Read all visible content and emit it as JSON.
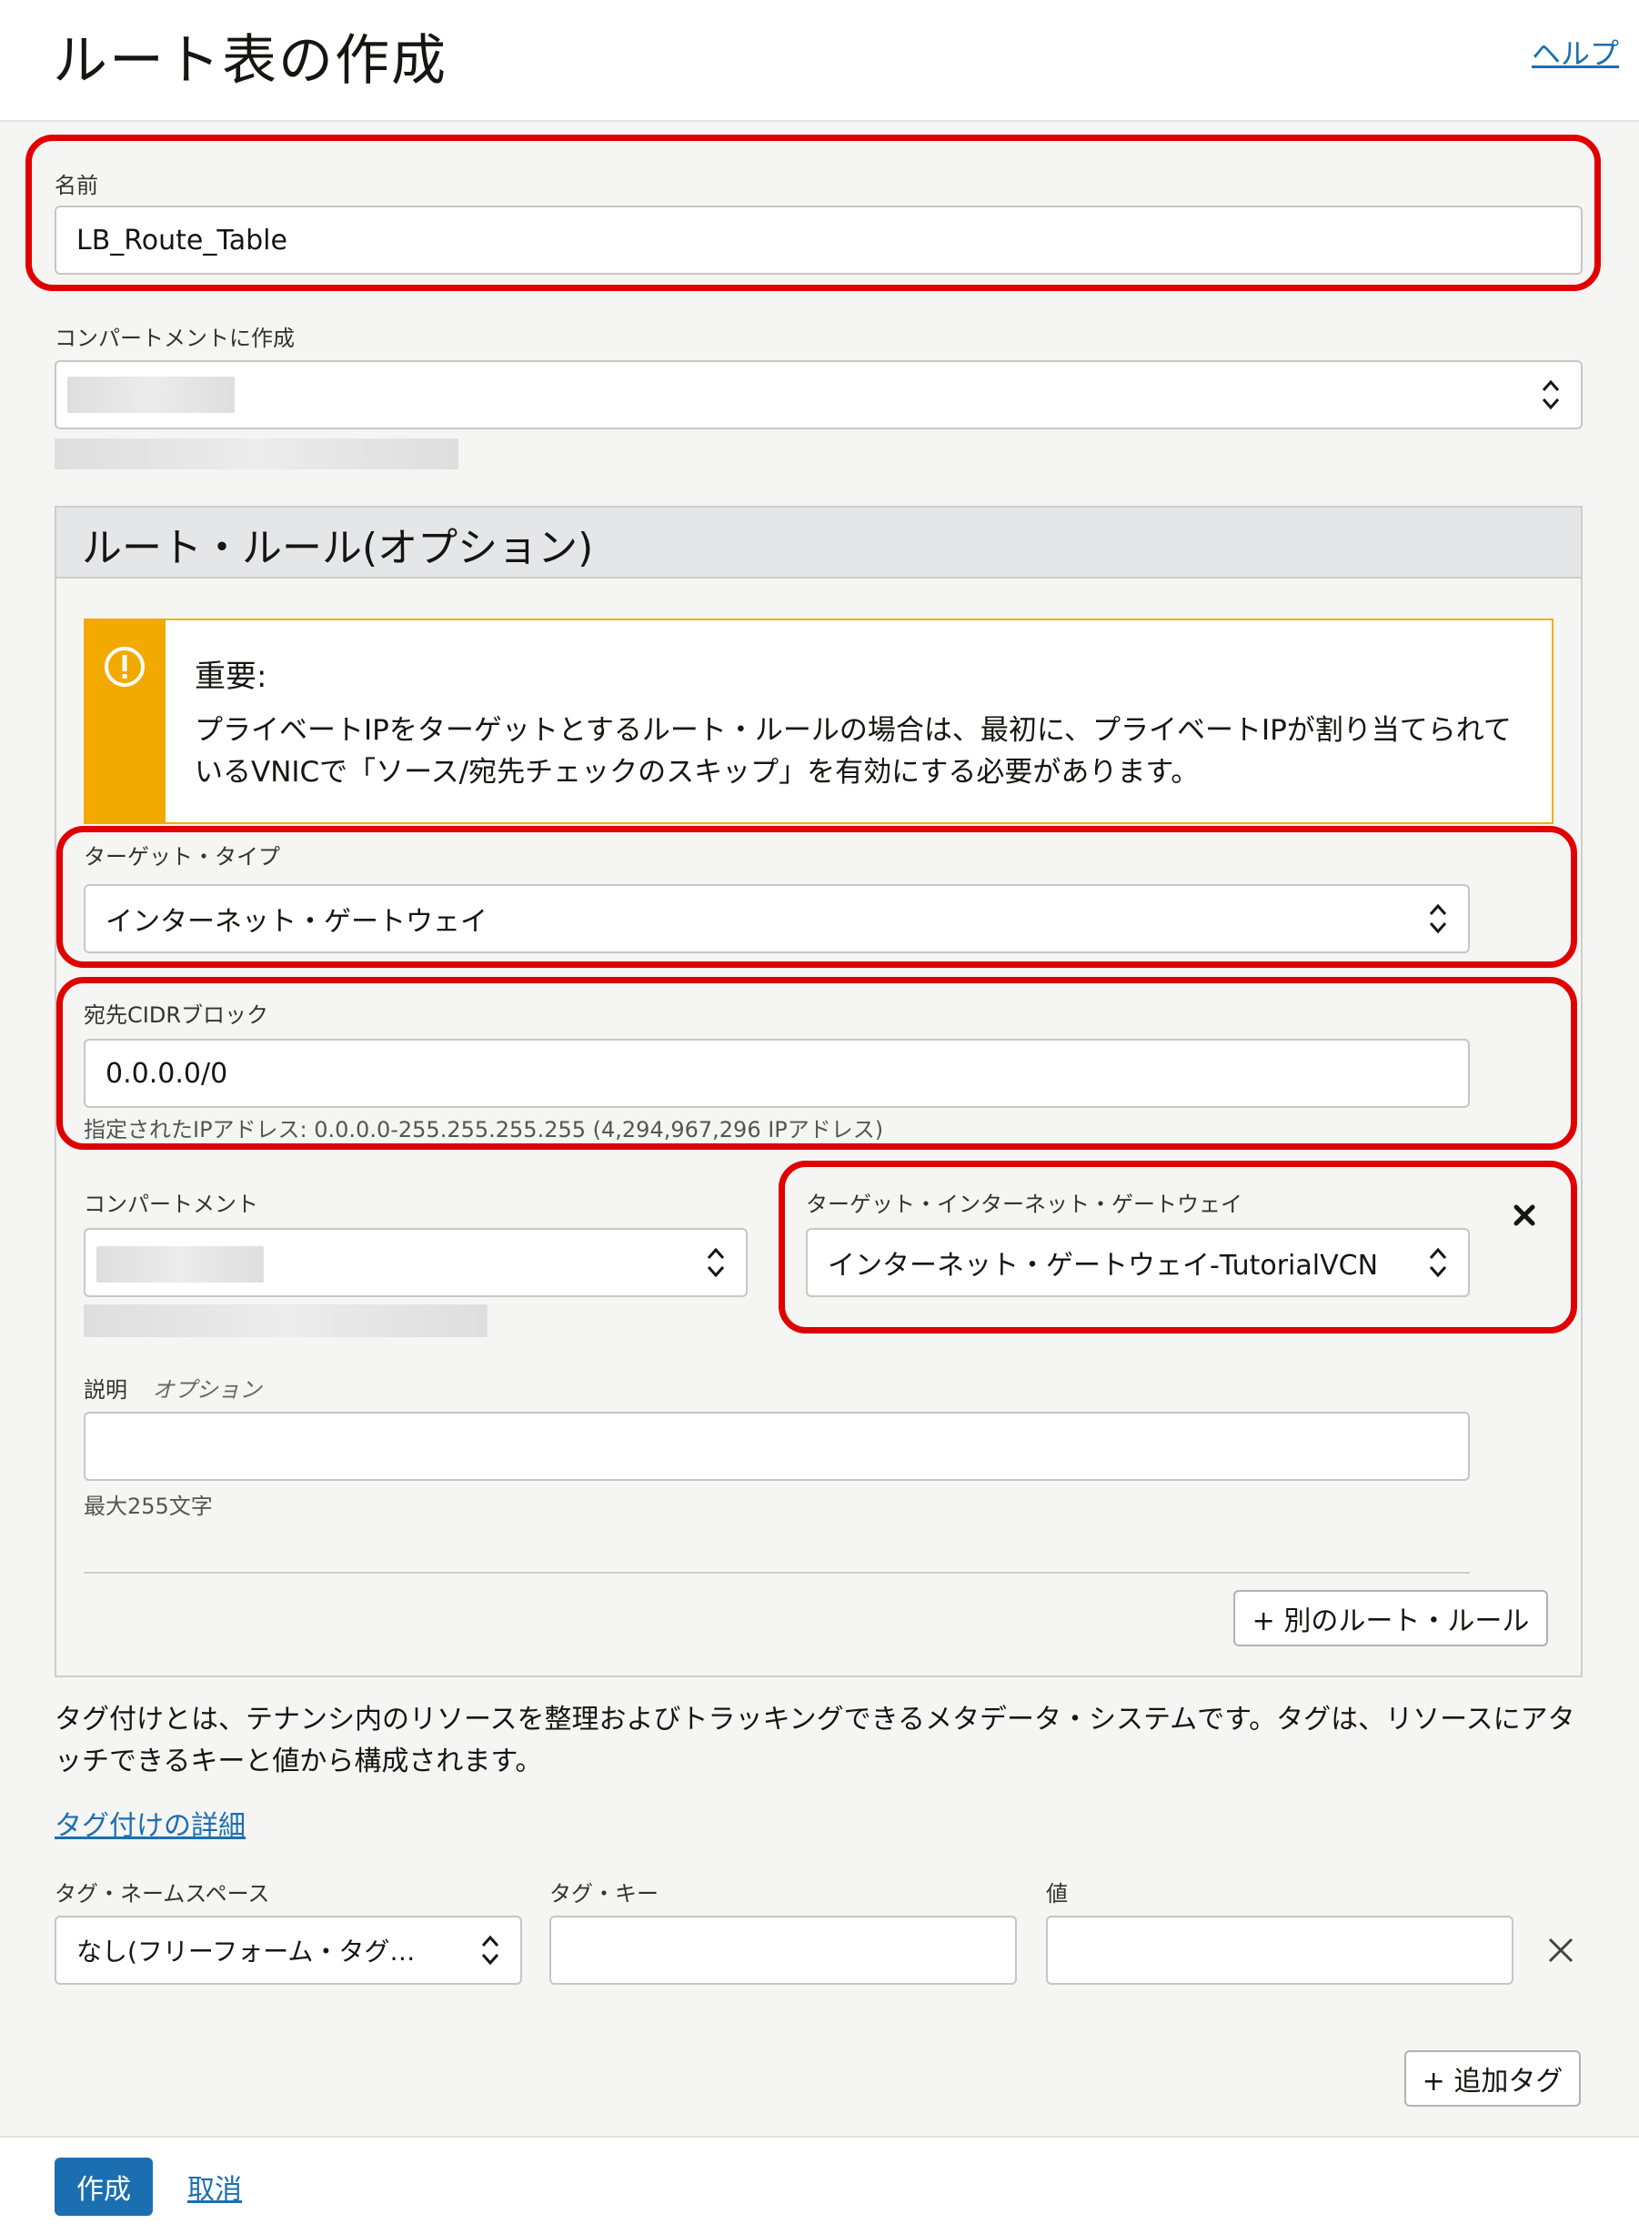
{
  "header": {
    "title": "ルート表の作成",
    "help": "ヘルプ"
  },
  "name": {
    "label": "名前",
    "value": "LB_Route_Table"
  },
  "compartment": {
    "label": "コンパートメントに作成"
  },
  "route_rules": {
    "title": "ルート・ルール(オプション)",
    "warning": {
      "title": "重要:",
      "body": "プライベートIPをターゲットとするルート・ルールの場合は、最初に、プライベートIPが割り当てられているVNICで「ソース/宛先チェックのスキップ」を有効にする必要があります。"
    },
    "target_type": {
      "label": "ターゲット・タイプ",
      "value": "インターネット・ゲートウェイ"
    },
    "cidr": {
      "label": "宛先CIDRブロック",
      "value": "0.0.0.0/0",
      "hint": "指定されたIPアドレス: 0.0.0.0-255.255.255.255 (4,294,967,296 IPアドレス)"
    },
    "rule_compartment": {
      "label": "コンパートメント"
    },
    "target_gateway": {
      "label": "ターゲット・インターネット・ゲートウェイ",
      "value": "インターネット・ゲートウェイ-TutorialVCN"
    },
    "description": {
      "label": "説明",
      "optional": "オプション",
      "hint": "最大255文字"
    },
    "add_rule": "+ 別のルート・ルール"
  },
  "tagging": {
    "intro": "タグ付けとは、テナンシ内のリソースを整理およびトラッキングできるメタデータ・システムです。タグは、リソースにアタッチできるキーと値から構成されます。",
    "learn_more": "タグ付けの詳細",
    "namespace_label": "タグ・ネームスペース",
    "namespace_value": "なし(フリーフォーム・タグ…",
    "key_label": "タグ・キー",
    "value_label": "値",
    "add_tag": "+ 追加タグ"
  },
  "footer": {
    "create": "作成",
    "cancel": "取消"
  },
  "colors": {
    "accent": "#1b6fb0",
    "highlight": "#e00000",
    "warning": "#f2a900"
  },
  "icons": [
    "chevron-updown-icon",
    "warning-icon",
    "close-icon"
  ]
}
